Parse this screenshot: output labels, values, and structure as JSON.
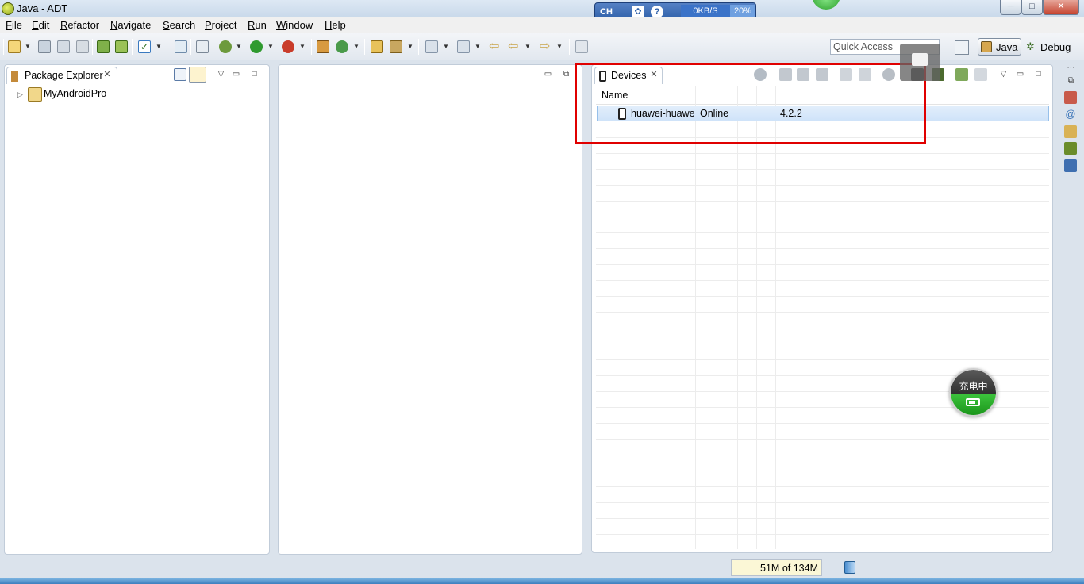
{
  "window": {
    "title": "Java - ADT",
    "controls": {
      "minimize": "─",
      "maximize": "□",
      "close": "✕"
    }
  },
  "ime_widget": {
    "lang": "CH",
    "speed": "0KB/S",
    "percent": "20%"
  },
  "menu": [
    "File",
    "Edit",
    "Refactor",
    "Navigate",
    "Search",
    "Project",
    "Run",
    "Window",
    "Help"
  ],
  "quick_access": {
    "placeholder": "Quick Access"
  },
  "perspectives": {
    "java": "Java",
    "debug": "Debug"
  },
  "package_explorer": {
    "tab_label": "Package Explorer",
    "tree": [
      {
        "label": "MyAndroidPro"
      }
    ]
  },
  "devices_view": {
    "tab_label": "Devices",
    "columns": [
      "Name",
      "",
      "",
      "",
      ""
    ],
    "rows": [
      {
        "name": "huawei-huawe",
        "state": "Online",
        "version": "4.2.2"
      }
    ]
  },
  "charge_badge": {
    "label": "充电中"
  },
  "status_bar": {
    "heap": "51M of 134M"
  },
  "colors": {
    "highlight_box": "#e00000",
    "selected_row": "#cfe3f9",
    "charge_green": "#2cb02c"
  },
  "icons": [
    "new-wizard-icon",
    "save-icon",
    "save-all-icon",
    "print-icon",
    "android-sdk-manager-icon",
    "avd-manager-icon",
    "checkbox-icon",
    "lint-icon",
    "skip-breakpoints-icon",
    "debug-icon",
    "run-icon",
    "coverage-icon",
    "new-java-project-icon",
    "new-class-icon",
    "open-type-icon",
    "search-icon",
    "next-annotation-icon",
    "prev-annotation-icon",
    "back-icon",
    "forward-icon",
    "pin-editor-icon"
  ]
}
